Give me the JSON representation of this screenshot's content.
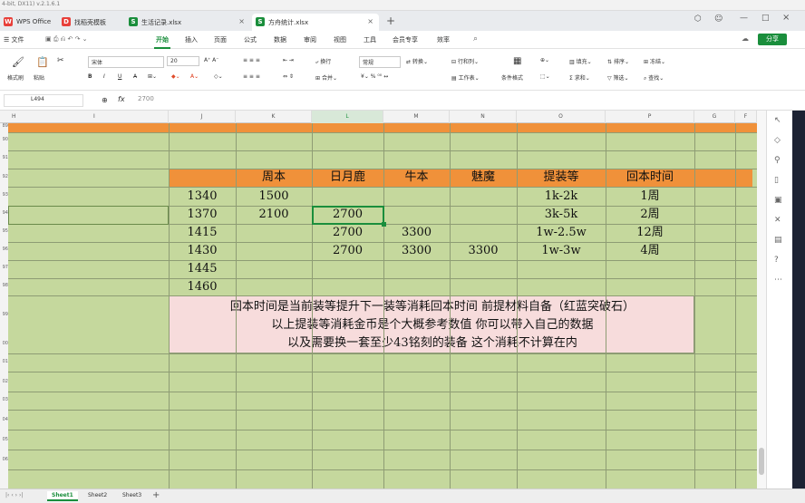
{
  "window": {
    "title_fragment": "4-bit, DX11) v.2.1.6.1"
  },
  "tabs": [
    {
      "label": "WPS Office",
      "icon": "wps-logo-icon",
      "color": "#e8403a"
    },
    {
      "label": "找稻壳模板",
      "icon": "docer-icon",
      "color": "#e8403a"
    },
    {
      "label": "生活记录.xlsx",
      "icon": "sheet-icon",
      "color": "#1a8e3c"
    },
    {
      "label": "方舟统计.xlsx",
      "icon": "sheet-icon",
      "color": "#1a8e3c"
    }
  ],
  "menubar": {
    "file": "文件",
    "items": [
      "开始",
      "插入",
      "页面",
      "公式",
      "数据",
      "审阅",
      "视图",
      "工具",
      "会员专享",
      "效率"
    ],
    "active": "开始",
    "share": "分享"
  },
  "ribbon": {
    "format_painter": "格式刷",
    "paste": "粘贴",
    "font": "宋体",
    "size": "20",
    "wrap": "换行",
    "merge": "合并",
    "number_format": "常规",
    "convert": "转换",
    "rows_cols": "行和列",
    "worksheet": "工作表",
    "cond_format": "条件格式",
    "fill": "填充",
    "sort": "排序",
    "freeze": "冻结",
    "sum": "求和",
    "filter": "筛选",
    "find": "查找"
  },
  "formula": {
    "cell_ref": "L494",
    "fx": "fx",
    "value": "2700"
  },
  "grid": {
    "columns": [
      "H",
      "I",
      "J",
      "K",
      "L",
      "M",
      "N",
      "O",
      "P",
      "G",
      "F"
    ],
    "selected_column": "L",
    "rows": [
      "89",
      "90",
      "91",
      "92",
      "93",
      "94",
      "95",
      "96",
      "97",
      "98",
      "99",
      "00",
      "01",
      "02",
      "03",
      "04",
      "05",
      "06"
    ],
    "header": [
      "周本",
      "日月鹿",
      "牛本",
      "魅魔",
      "提装等",
      "回本时间"
    ],
    "data": [
      [
        "1340",
        "1500",
        "",
        "",
        "",
        "1k-2k",
        "1周"
      ],
      [
        "1370",
        "2100",
        "2700",
        "",
        "",
        "3k-5k",
        "2周"
      ],
      [
        "1415",
        "",
        "2700",
        "3300",
        "",
        "1w-2.5w",
        "12周"
      ],
      [
        "1430",
        "",
        "2700",
        "3300",
        "3300",
        "1w-3w",
        "4周"
      ],
      [
        "1445",
        "",
        "",
        "",
        "",
        "",
        ""
      ],
      [
        "1460",
        "",
        "",
        "",
        "",
        "",
        ""
      ]
    ],
    "notes": [
      "回本时间是当前装等提升下一装等消耗回本时间 前提材料自备（红蓝突破石）",
      "以上提装等消耗金币是个大概参考数值 你可以带入自己的数据",
      "以及需要换一套至少43铭刻的装备 这个消耗不计算在内"
    ],
    "colors": {
      "grid_bg": "#c5d89d",
      "header_orange": "#f0913a",
      "note_pink": "#f7dcdc",
      "selected": "#1a8e3c"
    }
  },
  "sheets": [
    "Sheet1",
    "Sheet2",
    "Sheet3"
  ],
  "active_sheet": "Sheet1"
}
